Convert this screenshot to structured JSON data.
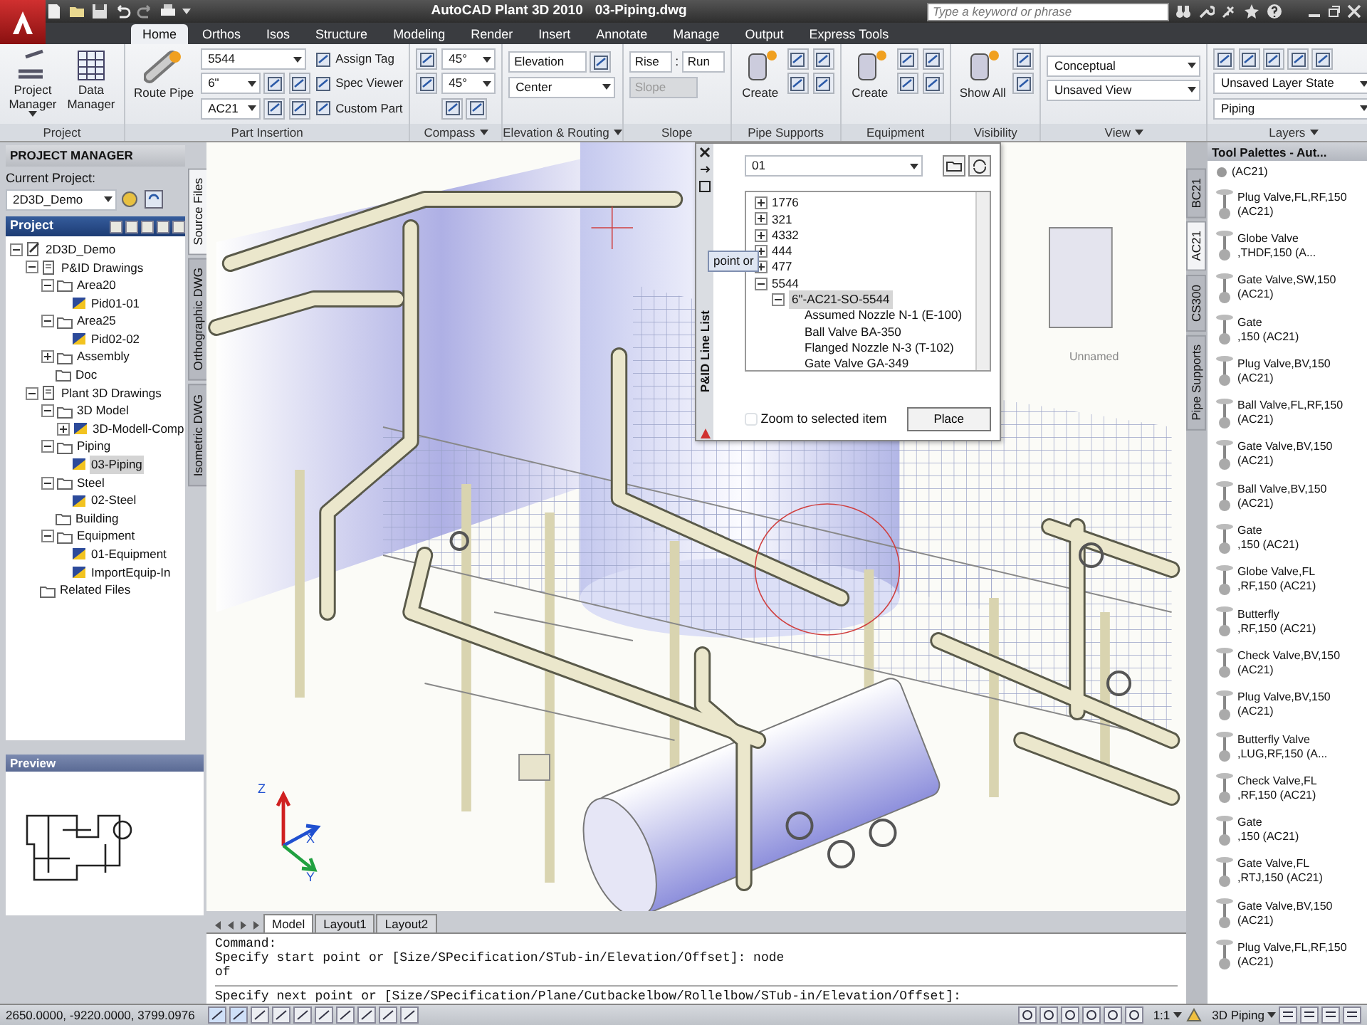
{
  "window": {
    "app_title": "AutoCAD Plant 3D 2010",
    "file_title": "03-Piping.dwg",
    "search_placeholder": "Type a keyword or phrase"
  },
  "ribbon_tabs": [
    {
      "label": "Home",
      "selected": true
    },
    {
      "label": "Orthos",
      "selected": false
    },
    {
      "label": "Isos",
      "selected": false
    },
    {
      "label": "Structure",
      "selected": false
    },
    {
      "label": "Modeling",
      "selected": false
    },
    {
      "label": "Render",
      "selected": false
    },
    {
      "label": "Insert",
      "selected": false
    },
    {
      "label": "Annotate",
      "selected": false
    },
    {
      "label": "Manage",
      "selected": false
    },
    {
      "label": "Output",
      "selected": false
    },
    {
      "label": "Express Tools",
      "selected": false
    }
  ],
  "ribbon_panels": [
    {
      "kind": "project",
      "title": "Project",
      "buttons": [
        {
          "label": "Project Manager",
          "has_menu": true
        },
        {
          "label": "Data Manager"
        }
      ]
    },
    {
      "kind": "part_insertion",
      "title": "Part Insertion",
      "large_button": "Route Pipe",
      "combos": [
        "5544",
        "6\"",
        "AC21"
      ],
      "tools": [
        "Assign Tag",
        "Spec Viewer",
        "Custom Part"
      ]
    },
    {
      "kind": "compass",
      "title": "Compass",
      "has_menu": true,
      "combos": [
        "45°",
        "45°"
      ]
    },
    {
      "kind": "elevation",
      "title": "Elevation & Routing",
      "has_menu": true,
      "field": "Elevation",
      "combo": "Center"
    },
    {
      "kind": "slope",
      "title": "Slope",
      "separator": ":",
      "fields": [
        {
          "value": "Rise",
          "disabled": false
        },
        {
          "value": "Run",
          "disabled": false
        },
        {
          "value": "Slope",
          "disabled": true
        }
      ]
    },
    {
      "kind": "create",
      "title": "Pipe Supports",
      "large_button": "Create"
    },
    {
      "kind": "create",
      "title": "Equipment",
      "large_button": "Create"
    },
    {
      "kind": "create",
      "title": "Visibility",
      "large_button": "Show All"
    },
    {
      "kind": "combos",
      "title": "View",
      "has_menu": true,
      "combos": [
        "Conceptual",
        "Unsaved View"
      ]
    },
    {
      "kind": "combos",
      "title": "Layers",
      "has_menu": true,
      "combos": [
        "Unsaved Layer State",
        "Piping"
      ]
    }
  ],
  "project_manager": {
    "title": "PROJECT MANAGER",
    "current_project_label": "Current Project:",
    "current_project": "2D3D_Demo",
    "tree_title": "Project",
    "side_tabs": [
      {
        "label": "Source Files",
        "selected": true
      },
      {
        "label": "Orthographic DWG",
        "selected": false
      },
      {
        "label": "Isometric DWG",
        "selected": false
      }
    ],
    "tree": [
      {
        "label": "2D3D_Demo",
        "kind": "project",
        "expanded": true,
        "selected": false,
        "children": [
          {
            "label": "P&ID Drawings",
            "kind": "set",
            "expanded": true,
            "selected": false,
            "children": [
              {
                "label": "Area20",
                "kind": "folder",
                "expanded": true,
                "selected": false,
                "children": [
                  {
                    "label": "Pid01-01",
                    "kind": "drawing",
                    "selected": false
                  }
                ]
              },
              {
                "label": "Area25",
                "kind": "folder",
                "expanded": true,
                "selected": false,
                "children": [
                  {
                    "label": "Pid02-02",
                    "kind": "drawing",
                    "selected": false
                  }
                ]
              },
              {
                "label": "Assembly",
                "kind": "folder",
                "expanded": false,
                "selected": false
              },
              {
                "label": "Doc",
                "kind": "folder",
                "selected": false
              }
            ]
          },
          {
            "label": "Plant 3D Drawings",
            "kind": "set",
            "expanded": true,
            "selected": false,
            "children": [
              {
                "label": "3D Model",
                "kind": "folder",
                "expanded": true,
                "selected": false,
                "children": [
                  {
                    "label": "3D-Modell-Comp",
                    "kind": "drawing",
                    "expanded": false,
                    "selected": false
                  }
                ]
              },
              {
                "label": "Piping",
                "kind": "folder",
                "expanded": true,
                "selected": false,
                "children": [
                  {
                    "label": "03-Piping",
                    "kind": "drawing",
                    "selected": true
                  }
                ]
              },
              {
                "label": "Steel",
                "kind": "folder",
                "expanded": true,
                "selected": false,
                "children": [
                  {
                    "label": "02-Steel",
                    "kind": "drawing",
                    "selected": false
                  }
                ]
              },
              {
                "label": "Building",
                "kind": "folder",
                "selected": false
              },
              {
                "label": "Equipment",
                "kind": "folder",
                "expanded": true,
                "selected": false,
                "children": [
                  {
                    "label": "01-Equipment",
                    "kind": "drawing",
                    "selected": false
                  },
                  {
                    "label": "ImportEquip-In",
                    "kind": "drawing",
                    "selected": false
                  }
                ]
              }
            ]
          },
          {
            "label": "Related Files",
            "kind": "folder",
            "selected": false
          }
        ]
      }
    ]
  },
  "preview": {
    "title": "Preview"
  },
  "line_list": {
    "title": "P&ID Line List",
    "drawing": "01",
    "tree": [
      {
        "label": "1776",
        "expanded": false,
        "selected": false
      },
      {
        "label": "321",
        "expanded": false,
        "selected": false
      },
      {
        "label": "4332",
        "expanded": false,
        "selected": false
      },
      {
        "label": "444",
        "expanded": false,
        "selected": false
      },
      {
        "label": "477",
        "expanded": false,
        "selected": false
      },
      {
        "label": "5544",
        "expanded": true,
        "selected": false,
        "children": [
          {
            "label": "6\"-AC21-SO-5544",
            "expanded": true,
            "selected": true,
            "children": [
              {
                "label": "Assumed Nozzle N-1 (E-100)",
                "selected": false
              },
              {
                "label": "Ball Valve BA-350",
                "selected": false
              },
              {
                "label": "Flanged Nozzle N-3 (T-102)",
                "selected": false
              },
              {
                "label": "Gate Valve GA-349",
                "selected": false
              }
            ]
          }
        ]
      }
    ],
    "zoom_checkbox": {
      "label": "Zoom to selected item",
      "checked": false
    },
    "place_button": "Place"
  },
  "viewport": {
    "equipment_label": "Unnamed",
    "tooltip": "point or",
    "axis_labels": {
      "x": "X",
      "y": "Y",
      "z": "Z"
    },
    "tabs": [
      {
        "label": "Model",
        "selected": true
      },
      {
        "label": "Layout1",
        "selected": false
      },
      {
        "label": "Layout2",
        "selected": false
      }
    ]
  },
  "command_line": {
    "history": [
      "Command:",
      "Specify start point or [Size/SPecification/STub-in/Elevation/Offset]: node",
      "of"
    ],
    "prompt": "Specify next point or [Size/SPecification/Plane/Cutbackelbow/Rollelbow/STub-in/Elevation/Offset]:"
  },
  "tool_palette": {
    "title": "Tool Palettes - Aut...",
    "tabs": [
      {
        "label": "BC21",
        "selected": false
      },
      {
        "label": "AC21",
        "selected": true
      },
      {
        "label": "CS300",
        "selected": false
      },
      {
        "label": "Pipe Supports",
        "selected": false
      }
    ],
    "items": [
      {
        "spec": "(AC21)"
      },
      {
        "name": "Plug Valve,FL,RF,150",
        "spec": "(AC21)"
      },
      {
        "name": "Globe Valve",
        "spec": ",THDF,150 (A..."
      },
      {
        "name": "Gate Valve,SW,150",
        "spec": "(AC21)"
      },
      {
        "name": "Gate",
        "spec": ",150 (AC21)"
      },
      {
        "name": "Plug Valve,BV,150",
        "spec": "(AC21)"
      },
      {
        "name": "Ball Valve,FL,RF,150",
        "spec": "(AC21)"
      },
      {
        "name": "Gate Valve,BV,150",
        "spec": "(AC21)"
      },
      {
        "name": "Ball Valve,BV,150",
        "spec": "(AC21)"
      },
      {
        "name": "Gate",
        "spec": ",150 (AC21)"
      },
      {
        "name": "Globe Valve,FL",
        "spec": ",RF,150 (AC21)"
      },
      {
        "name": "Butterfly",
        "spec": ",RF,150 (AC21)"
      },
      {
        "name": "Check Valve,BV,150",
        "spec": "(AC21)"
      },
      {
        "name": "Plug Valve,BV,150",
        "spec": "(AC21)"
      },
      {
        "name": "Butterfly Valve",
        "spec": ",LUG,RF,150 (A..."
      },
      {
        "name": "Check Valve,FL",
        "spec": ",RF,150 (AC21)"
      },
      {
        "name": "Gate",
        "spec": ",150 (AC21)"
      },
      {
        "name": "Gate Valve,FL",
        "spec": ",RTJ,150 (AC21)"
      },
      {
        "name": "Gate Valve,BV,150",
        "spec": "(AC21)"
      },
      {
        "name": "Plug Valve,FL,RF,150",
        "spec": "(AC21)"
      }
    ]
  },
  "status_bar": {
    "coordinates": "2650.0000, -9220.0000, 3799.0976",
    "scale": "1:1",
    "workspace": "3D Piping"
  }
}
